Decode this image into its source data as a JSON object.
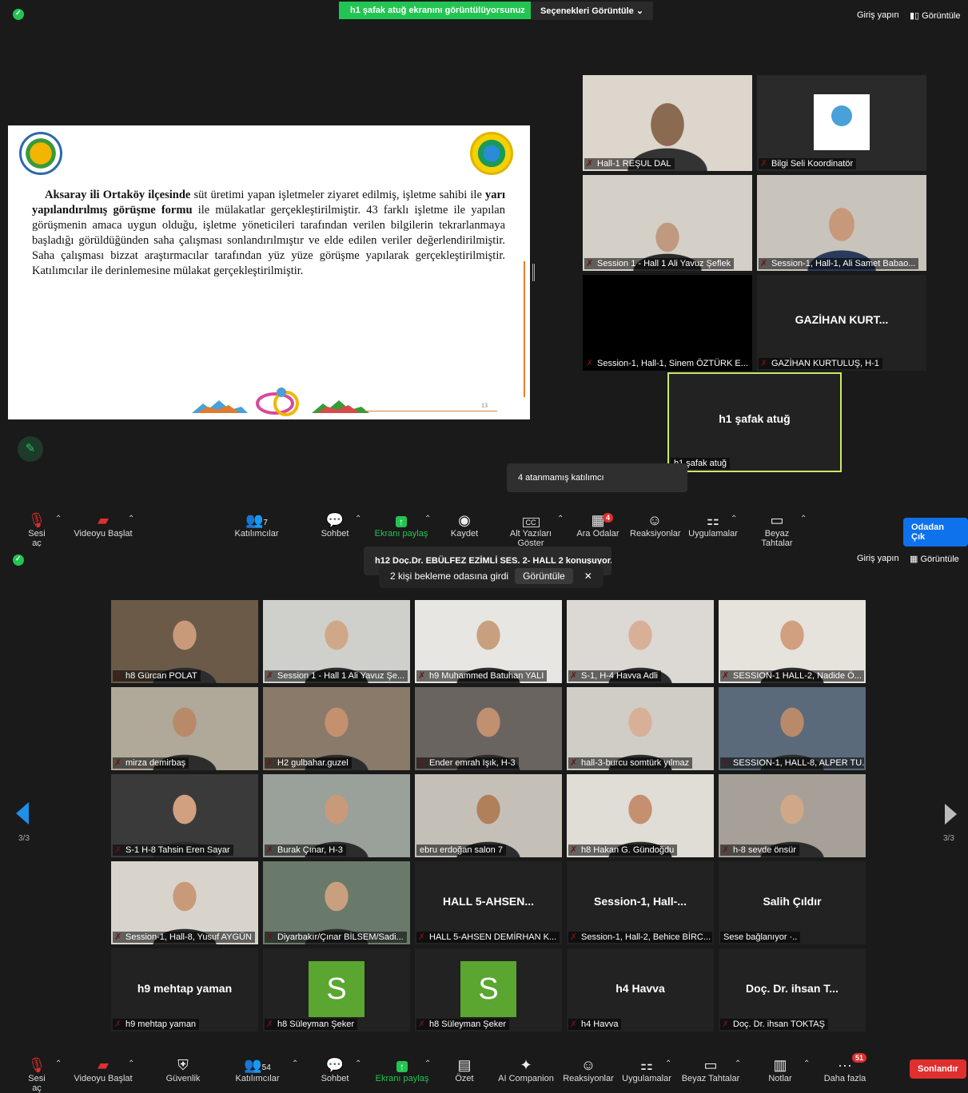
{
  "top": {
    "share_banner": "h1 şafak atuğ ekranını görüntülüyorsunuz",
    "view_options": "Seçenekleri Görüntüle",
    "sign_in": "Giriş yapın",
    "view": "Görüntüle",
    "slide": {
      "paragraph_bold_1": "Aksaray ili Ortaköy ilçesinde",
      "paragraph_1": " süt üretimi yapan işletmeler ziyaret edilmiş, işletme sahibi ile ",
      "paragraph_bold_2": "yarı yapılandırılmış görüşme formu",
      "paragraph_2": " ile mülakatlar gerçekleştirilmiştir. 43 farklı işletme ile yapılan görüşmenin amaca uygun olduğu, işletme yöneticileri tarafından verilen bilgilerin tekrarlanmaya başladığı görüldüğünden saha çalışması sonlandırılmıştır ve elde edilen veriler değerlendirilmiştir. Saha çalışması bizzat araştırmacılar tarafından yüz yüze görüşme yapılarak gerçekleştirilmiştir. Katılımcılar ile derinlemesine mülakat gerçekleştirilmiştir.",
      "page_number": "13"
    },
    "participants": [
      {
        "name": "Hall-1 REŞUL DAL",
        "video": true
      },
      {
        "name": "Bilgi Seli Koordinatör",
        "video": true
      },
      {
        "name": "Session 1 - Hall 1 Ali Yavuz Şeflek",
        "video": true
      },
      {
        "name": "Session-1, Hall-1, Ali Samet Babao...",
        "video": true
      },
      {
        "name": "Session-1, Hall-1, Sinem ÖZTÜRK E...",
        "video": false,
        "big": ""
      },
      {
        "name": "GAZİHAN KURTULUŞ, H-1",
        "video": false,
        "big": "GAZİHAN  KURT..."
      }
    ],
    "active_speaker": {
      "big": "h1 şafak atuğ",
      "name": "h1 şafak atuğ"
    },
    "tooltip": "4 atanmamış katılımcı",
    "toolbar": {
      "audio": "Sesi aç",
      "video": "Videoyu Başlat",
      "participants": "Katılımcılar",
      "participants_count": "7",
      "chat": "Sohbet",
      "share": "Ekranı paylaş",
      "record": "Kaydet",
      "captions": "Alt Yazıları Göster",
      "breakout": "Ara Odalar",
      "breakout_badge": "4",
      "reactions": "Reaksiyonlar",
      "apps": "Uygulamalar",
      "whiteboard": "Beyaz Tahtalar",
      "leave": "Odadan Çık"
    }
  },
  "bottom": {
    "sign_in": "Giriş yapın",
    "view": "Görüntüle",
    "speaking": "h12 Doç.Dr. EBÜLFEZ EZİMLİ SES. 2- HALL 2 konuşuyor...",
    "notice": "2 kişi bekleme odasına girdi",
    "notice_view": "Görüntüle",
    "page_left": "3/3",
    "page_right": "3/3",
    "grid": [
      {
        "name": "h8 Gürcan POLAT",
        "video": true
      },
      {
        "name": "Session 1 - Hall 1 Ali Yavuz Şe...",
        "video": true
      },
      {
        "name": "h9 Muhammed Batuhan YALI",
        "video": true
      },
      {
        "name": "S-1, H-4 Havva Adli",
        "video": true
      },
      {
        "name": "SESSION-1 HALL-2, Nadide Ö...",
        "video": true
      },
      {
        "name": "mirza demirbaş",
        "video": true
      },
      {
        "name": "H2 gulbahar.guzel",
        "video": true
      },
      {
        "name": "Ender emrah Işık, H-3",
        "video": true
      },
      {
        "name": "hall-3-burcu somtürk yılmaz",
        "video": true
      },
      {
        "name": "SESSION-1, HALL-8, ALPER TU...",
        "video": true
      },
      {
        "name": "S-1 H-8 Tahsin Eren Sayar",
        "video": true
      },
      {
        "name": "Burak Çınar, H-3",
        "video": true
      },
      {
        "name": "ebru erdoğan salon 7",
        "video": true,
        "unmuted": true
      },
      {
        "name": "h8 Hakan G. Gündoğdu",
        "video": true
      },
      {
        "name": "h-8 sevde önsür",
        "video": true
      },
      {
        "name": "Session-1, Hall-8, Yusuf AYGÜN",
        "video": true
      },
      {
        "name": "Diyarbakır/Çınar BİLSEM/Sadi...",
        "video": true
      },
      {
        "name": "HALL 5-AHSEN DEMİRHAN K...",
        "video": false,
        "big": "HALL 5-AHSEN..."
      },
      {
        "name": "Session-1, Hall-2, Behice BİRC...",
        "video": false,
        "big": "Session-1,  Hall-..."
      },
      {
        "name": "Sese bağlanıyor ·..",
        "video": false,
        "big": "Salih Çıldır",
        "unmuted": true
      },
      {
        "name": "h9 mehtap yaman",
        "video": false,
        "big": "h9 mehtap yaman"
      },
      {
        "name": "h8 Süleyman Şeker",
        "video": false,
        "avatar": "S"
      },
      {
        "name": "h8 Süleyman Şeker",
        "video": false,
        "avatar": "S"
      },
      {
        "name": "h4 Havva",
        "video": false,
        "big": "h4 Havva"
      },
      {
        "name": "Doç. Dr. ihsan TOKTAŞ",
        "video": false,
        "big": "Doç. Dr. ihsan T..."
      }
    ],
    "toolbar": {
      "audio": "Sesi aç",
      "video": "Videoyu Başlat",
      "security": "Güvenlik",
      "participants": "Katılımcılar",
      "participants_count": "54",
      "chat": "Sohbet",
      "share": "Ekranı paylaş",
      "summary": "Özet",
      "ai": "AI Companion",
      "reactions": "Reaksiyonlar",
      "apps": "Uygulamalar",
      "whiteboard": "Beyaz Tahtalar",
      "notes": "Notlar",
      "more": "Daha fazla",
      "more_badge": "51",
      "end": "Sonlandır"
    }
  }
}
